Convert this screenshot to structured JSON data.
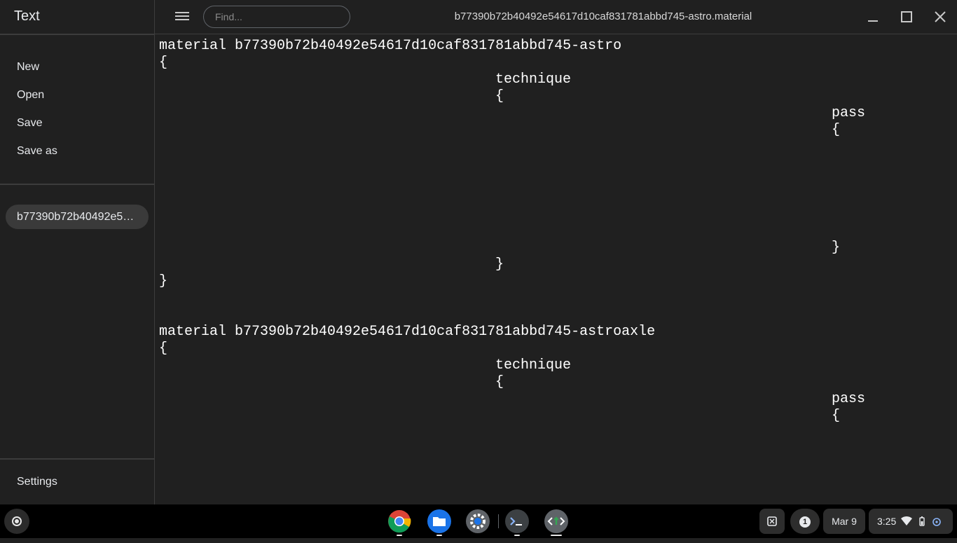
{
  "app": {
    "title": "Text"
  },
  "sidebar": {
    "items": [
      {
        "label": "New"
      },
      {
        "label": "Open"
      },
      {
        "label": "Save"
      },
      {
        "label": "Save as"
      }
    ],
    "open_file": "b77390b72b40492e54617d10caf831781abbd745-astro.material",
    "settings_label": "Settings"
  },
  "header": {
    "find_placeholder": "Find...",
    "doc_title": "b77390b72b40492e54617d10caf831781abbd745-astro.material"
  },
  "editor": {
    "lines": [
      "material b77390b72b40492e54617d10caf831781abbd745-astro",
      "{",
      "technique",
      "{",
      "pass",
      "{",
      "}",
      "}",
      "}",
      "material b77390b72b40492e54617d10caf831781abbd745-astroaxle",
      "{",
      "technique",
      "{",
      "pass",
      "{"
    ]
  },
  "shelf": {
    "apps": [
      "chrome-icon",
      "files-icon",
      "settings-icon",
      "terminal-icon",
      "text-app-icon"
    ],
    "notification_count": "1",
    "date": "Mar 9",
    "time": "3:25"
  },
  "colors": {
    "background": "#202020",
    "divider": "#3c3c3c",
    "text": "#e8eaed",
    "shelf": "#000000"
  }
}
